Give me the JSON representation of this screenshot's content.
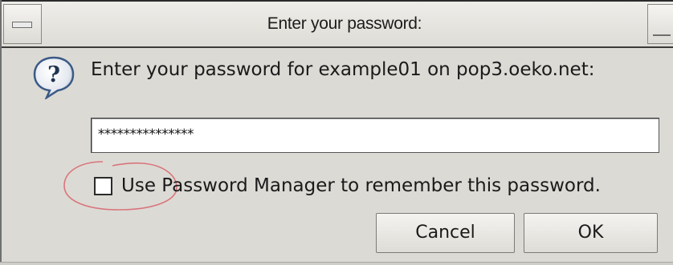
{
  "window": {
    "title": "Enter your password:"
  },
  "dialog": {
    "icon": "question-icon",
    "prompt": "Enter your password for example01 on pop3.oeko.net:",
    "password_value": "***************",
    "checkbox_label": "Use Password Manager to remember this password.",
    "checkbox_checked": false,
    "cancel_label": "Cancel",
    "ok_label": "OK"
  },
  "colors": {
    "dialog_bg": "#dcdad5",
    "annotation": "#d9757a"
  }
}
